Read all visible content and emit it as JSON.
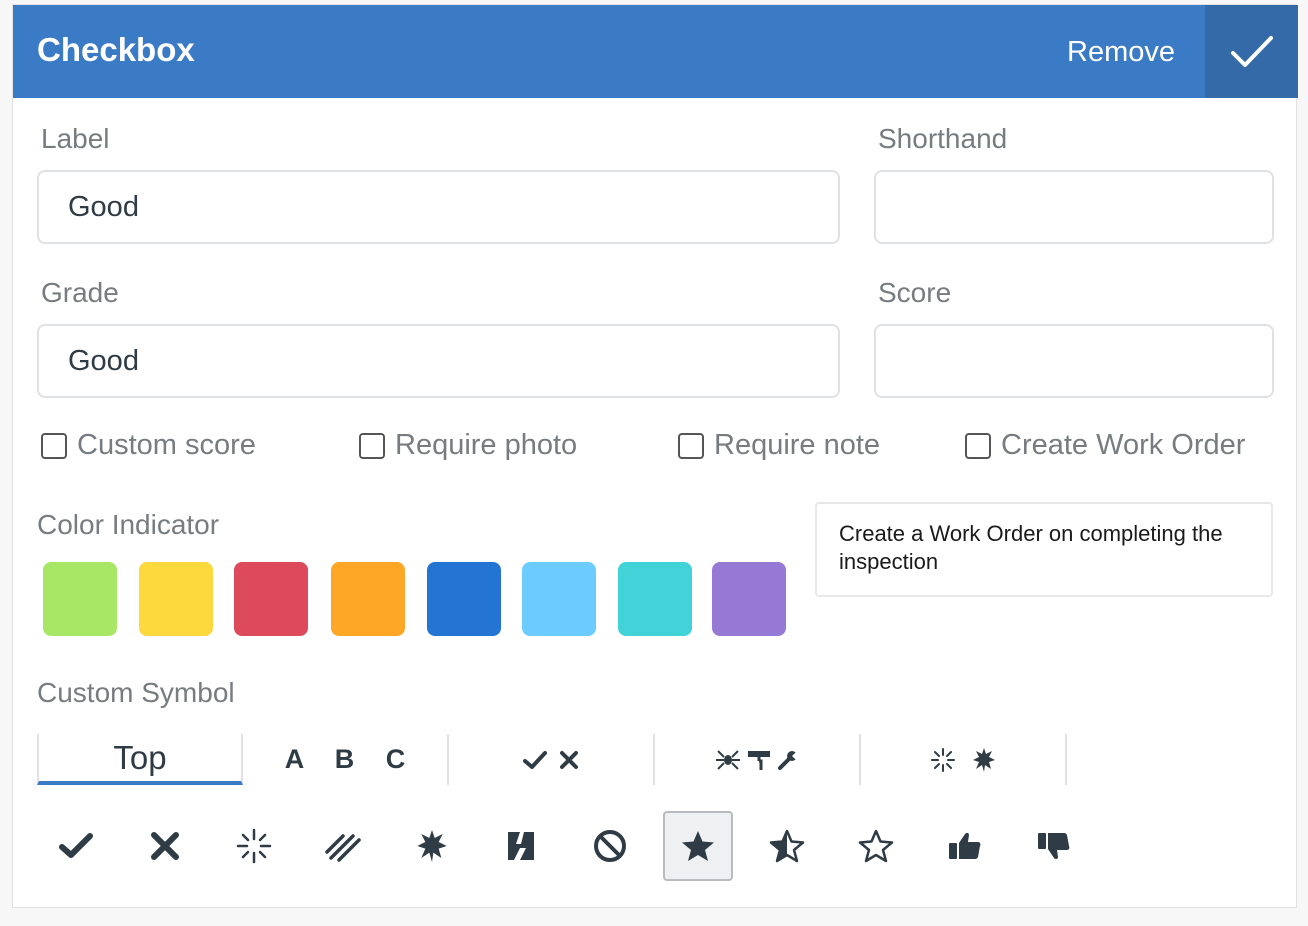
{
  "header": {
    "title": "Checkbox",
    "remove_label": "Remove"
  },
  "fields": {
    "label": {
      "label": "Label",
      "value": "Good"
    },
    "shorthand": {
      "label": "Shorthand",
      "value": ""
    },
    "grade": {
      "label": "Grade",
      "value": "Good"
    },
    "score": {
      "label": "Score",
      "value": ""
    }
  },
  "options": [
    {
      "label": "Custom score",
      "checked": false
    },
    {
      "label": "Require photo",
      "checked": false
    },
    {
      "label": "Require note",
      "checked": false
    },
    {
      "label": "Create Work Order",
      "checked": false
    }
  ],
  "tooltip": {
    "text": "Create a Work Order on completing the inspection"
  },
  "color_indicator": {
    "label": "Color Indicator",
    "colors": [
      "#a8e665",
      "#fdd93e",
      "#dc4a5c",
      "#fea726",
      "#2474d4",
      "#6dccff",
      "#42d3d8",
      "#9679d4"
    ]
  },
  "custom_symbol": {
    "label": "Custom Symbol",
    "tabs": [
      "Top",
      "A B C",
      "check-x-icons",
      "tools-icons",
      "misc-icons"
    ],
    "active_tab": "Top",
    "symbols": [
      "check-icon",
      "cross-icon",
      "sparkle-icon",
      "scratch-icon",
      "splat-icon",
      "broken-icon",
      "prohibited-icon",
      "star-filled-icon",
      "star-half-icon",
      "star-outline-icon",
      "thumbs-up-icon",
      "thumbs-down-icon"
    ],
    "selected_symbol": "star-filled-icon"
  },
  "colors": {
    "header": "#3b7bc6",
    "header_dark": "#346aa8",
    "icon": "#2f3b45"
  }
}
